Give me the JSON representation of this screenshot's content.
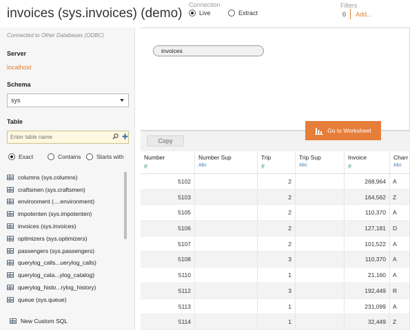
{
  "title": "invoices (sys.invoices) (demo)",
  "connection": {
    "label": "Connection",
    "options": [
      "Live",
      "Extract"
    ],
    "selected": "Live"
  },
  "filters": {
    "label": "Filters",
    "count": "0",
    "add": "Add..."
  },
  "sidebar": {
    "subtitle": "Connected to Other Databases (ODBC)",
    "server_label": "Server",
    "server_value": "localhost",
    "schema_label": "Schema",
    "schema_value": "sys",
    "table_label": "Table",
    "table_placeholder": "Enter table name",
    "match_options": [
      "Exact",
      "Contains",
      "Starts with"
    ],
    "match_selected": "Exact",
    "tables": [
      "columns (sys.columns)",
      "craftsmen (sys.craftsmen)",
      "environment (....environment)",
      "impotenten (sys.impotenten)",
      "invoices (sys.invoices)",
      "optimizers (sys.optimizers)",
      "passengers (sys.passengers)",
      "querylog_calls...uerylog_calls)",
      "querylog_cata...ylog_catalog)",
      "querylog_histo...rylog_history)",
      "queue (sys.queue)"
    ],
    "new_sql": "New Custom SQL"
  },
  "canvas": {
    "table_pill": "invoices",
    "goto_label": "Go to Worksheet"
  },
  "grid": {
    "copy_label": "Copy",
    "columns": [
      {
        "name": "Number",
        "type": "#"
      },
      {
        "name": "Number Sup",
        "type": "Abc"
      },
      {
        "name": "Trip",
        "type": "#"
      },
      {
        "name": "Trip Sup",
        "type": "Abc"
      },
      {
        "name": "Invoice",
        "type": "#"
      },
      {
        "name": "Charr",
        "type": "Abc"
      }
    ],
    "rows": [
      [
        "5102",
        "",
        "2",
        "",
        "268,964",
        "A"
      ],
      [
        "5103",
        "",
        "2",
        "",
        "164,562",
        "Z"
      ],
      [
        "5105",
        "",
        "2",
        "",
        "110,370",
        "A"
      ],
      [
        "5106",
        "",
        "2",
        "",
        "127,181",
        "D"
      ],
      [
        "5107",
        "",
        "2",
        "",
        "101,522",
        "A"
      ],
      [
        "5108",
        "",
        "3",
        "",
        "110,370",
        "A"
      ],
      [
        "5110",
        "",
        "1",
        "",
        "21,160",
        "A"
      ],
      [
        "5112",
        "",
        "3",
        "",
        "192,449",
        "R"
      ],
      [
        "5113",
        "",
        "1",
        "",
        "231,099",
        "A"
      ],
      [
        "5114",
        "",
        "1",
        "",
        "32,449",
        "Z"
      ]
    ]
  },
  "colors": {
    "accent": "#e07b2a",
    "button": "#e67e3a"
  }
}
